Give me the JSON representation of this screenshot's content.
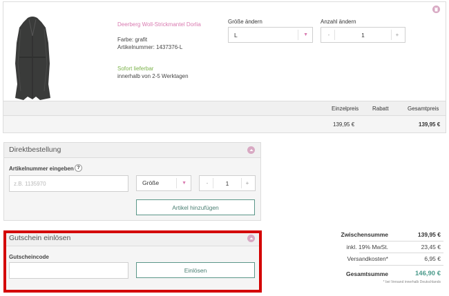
{
  "cart_item": {
    "name": "Deerberg Woll-Strickmantel Dorlia",
    "color": "Farbe: grafit",
    "sku": "Artikelnummer: 1437376-L",
    "availability": "Sofort lieferbar",
    "delivery": "innerhalb von 2-5 Werktagen",
    "size_label": "Größe ändern",
    "size_value": "L",
    "qty_label": "Anzahl ändern",
    "qty_value": "1",
    "minus": "-",
    "plus": "+"
  },
  "price_table": {
    "headers": {
      "unit": "Einzelpreis",
      "discount": "Rabatt",
      "total": "Gesamtpreis"
    },
    "row": {
      "unit": "139,95 €",
      "discount": "",
      "total": "139,95 €"
    }
  },
  "direct_order": {
    "title": "Direktbestellung",
    "sku_label": "Artikelnummer eingeben",
    "help": "?",
    "sku_placeholder": "z.B. 1135970",
    "size_value": "Größe",
    "qty_value": "1",
    "minus": "-",
    "plus": "+",
    "add_button": "Artikel hinzufügen"
  },
  "voucher": {
    "title": "Gutschein einlösen",
    "code_label": "Gutscheincode",
    "code_value": "",
    "redeem_button": "Einlösen"
  },
  "totals": {
    "subtotal_label": "Zwischensumme",
    "subtotal_value": "139,95 €",
    "vat_label": "inkl. 19% MwSt.",
    "vat_value": "23,45 €",
    "shipping_label": "Versandkosten*",
    "shipping_value": "6,95 €",
    "grand_label": "Gesamtsumme",
    "grand_value": "146,90 €",
    "footnote": "* bei Versand innerhalb Deutschlands"
  },
  "colors": {
    "accent_pink": "#d97ab0",
    "availability_green": "#7bb24a",
    "button_teal": "#5a9688",
    "highlight_red": "#d40000"
  }
}
